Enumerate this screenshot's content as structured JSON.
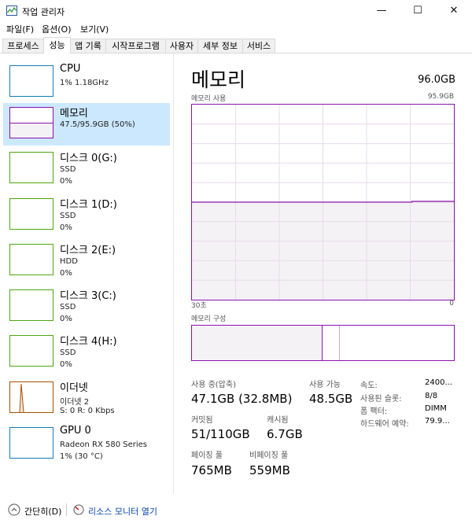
{
  "window": {
    "title": "작업 관리자",
    "minimize": "—",
    "maximize": "☐",
    "close": "✕"
  },
  "menu": [
    "파일(F)",
    "옵션(O)",
    "보기(V)"
  ],
  "tabs": [
    {
      "label": "프로세스"
    },
    {
      "label": "성능"
    },
    {
      "label": "앱 기록"
    },
    {
      "label": "시작프로그램"
    },
    {
      "label": "사용자"
    },
    {
      "label": "세부 정보"
    },
    {
      "label": "서비스"
    }
  ],
  "sidebar": [
    {
      "name": "CPU",
      "sub1": "1% 1.18GHz",
      "sub2": ""
    },
    {
      "name": "메모리",
      "sub1": "47.5/95.9GB (50%)",
      "sub2": ""
    },
    {
      "name": "디스크 0(G:)",
      "sub1": "SSD",
      "sub2": "0%"
    },
    {
      "name": "디스크 1(D:)",
      "sub1": "SSD",
      "sub2": "0%"
    },
    {
      "name": "디스크 2(E:)",
      "sub1": "HDD",
      "sub2": "0%"
    },
    {
      "name": "디스크 3(C:)",
      "sub1": "SSD",
      "sub2": "0%"
    },
    {
      "name": "디스크 4(H:)",
      "sub1": "SSD",
      "sub2": "0%"
    },
    {
      "name": "이더넷",
      "sub1": "이더넷 2",
      "sub2": "S: 0 R: 0 Kbps"
    },
    {
      "name": "GPU 0",
      "sub1": "Radeon RX 580 Series",
      "sub2": "1% (30 °C)"
    }
  ],
  "main": {
    "title": "메모리",
    "total": "96.0GB",
    "usage_label": "메모리 사용",
    "usage_max": "95.9GB",
    "x_left": "30초",
    "x_right": "0",
    "composition_label": "메모리 구성",
    "usage_fraction": 0.5
  },
  "stats": {
    "in_use_label": "사용 중(압축)",
    "in_use": "47.1GB (32.8MB)",
    "available_label": "사용 가능",
    "available": "48.5GB",
    "committed_label": "커밋됨",
    "committed": "51/110GB",
    "cached_label": "캐시됨",
    "cached": "6.7GB",
    "paged_label": "페이징 풀",
    "paged": "765MB",
    "nonpaged_label": "비페이징 풀",
    "nonpaged": "559MB"
  },
  "info": [
    {
      "label": "속도:",
      "value": "2400..."
    },
    {
      "label": "사용된 슬롯:",
      "value": "8/8"
    },
    {
      "label": "폼 팩터:",
      "value": "DIMM"
    },
    {
      "label": "하드웨어 예약:",
      "value": "79.9..."
    }
  ],
  "footer": {
    "fewer": "간단히(D)",
    "monitor": "리소스 모니터 열기"
  },
  "colors": {
    "memory": "#8b12ae",
    "memory_fill": "#f4f2f4",
    "selected": "#cce8ff",
    "cpu": "#117dbb",
    "disk": "#4da60c",
    "ethernet": "#a74f01"
  }
}
